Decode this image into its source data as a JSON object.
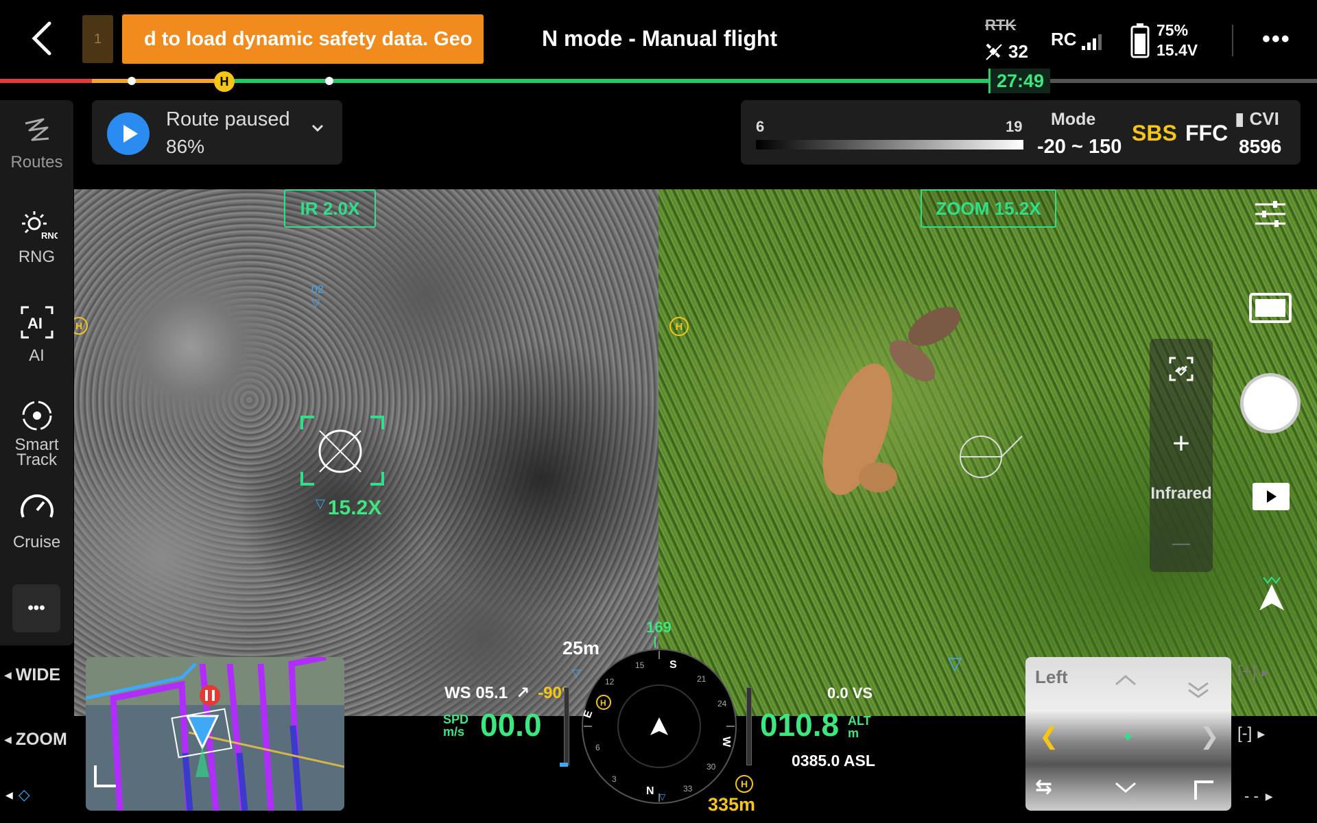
{
  "topbar": {
    "alert_number": "1",
    "alert_text": "d to load dynamic safety data. Geo",
    "title": "N mode - Manual flight",
    "rtk_label": "RTK",
    "satellites": "32",
    "rc_label": "RC",
    "battery_percent": "75%",
    "battery_voltage": "15.4V",
    "more_label": "•••"
  },
  "progress": {
    "flight_time": "27:49",
    "home_marker": "H",
    "played_fraction": 0.75
  },
  "route": {
    "status": "Route paused",
    "percent": "86%"
  },
  "thermal": {
    "range_low": "6",
    "range_high": "19",
    "mode_label": "Mode",
    "mode_value": "-20 ~ 150",
    "sbs_label": "SBS",
    "ffc_label": "FFC",
    "cvi_label": "CVI",
    "cvi_value": "8596"
  },
  "sidebar": {
    "items": [
      {
        "label": "Routes",
        "icon": "routes-icon"
      },
      {
        "label": "RNG",
        "icon": "rng-icon",
        "badge": "RNG"
      },
      {
        "label": "AI",
        "icon": "ai-icon",
        "badge": "AI"
      },
      {
        "label": "Smart\nTrack",
        "label_line1": "Smart",
        "label_line2": "Track",
        "icon": "smart-track-icon"
      },
      {
        "label": "Cruise",
        "icon": "cruise-icon"
      }
    ],
    "more_label": "•••"
  },
  "views": {
    "ir_label": "IR  2.0X",
    "zoom_label": "ZOOM  15.2X",
    "ir_marker": "02",
    "ir_zoom_ref": "15.2X",
    "home_marker": "H"
  },
  "right_controls": {
    "zoom_panel_label": "Infrared",
    "plus": "+",
    "minus": "—"
  },
  "left_bottom": {
    "wide_label": "WIDE",
    "zoom_label": "ZOOM"
  },
  "hud": {
    "distance_top": "25m",
    "heading": "169",
    "ws_label": "WS 05.1",
    "ws_angle": "-90°",
    "spd_label_1": "SPD",
    "spd_label_2": "m/s",
    "speed": "00.0",
    "vs": "0.0 VS",
    "altitude": "010.8",
    "alt_label_1": "ALT",
    "alt_label_2": "m",
    "asl": "0385.0 ASL",
    "home_distance": "335m",
    "home_marker": "H",
    "compass_labels": [
      "S",
      "W",
      "N",
      "E"
    ],
    "compass_numbers": [
      "15",
      "21",
      "24",
      "30",
      "33",
      "3",
      "6",
      "12"
    ]
  },
  "pip": {
    "label": "Left"
  },
  "bottom_right": {
    "zoom_in": "[+]",
    "zoom_out": "[-]",
    "dash": "- -"
  },
  "colors": {
    "accent_green": "#3ee67f",
    "warning_orange": "#f28b1d",
    "home_yellow": "#f5c518",
    "play_blue": "#2a8cf0",
    "route_purple": "#b02cff"
  }
}
